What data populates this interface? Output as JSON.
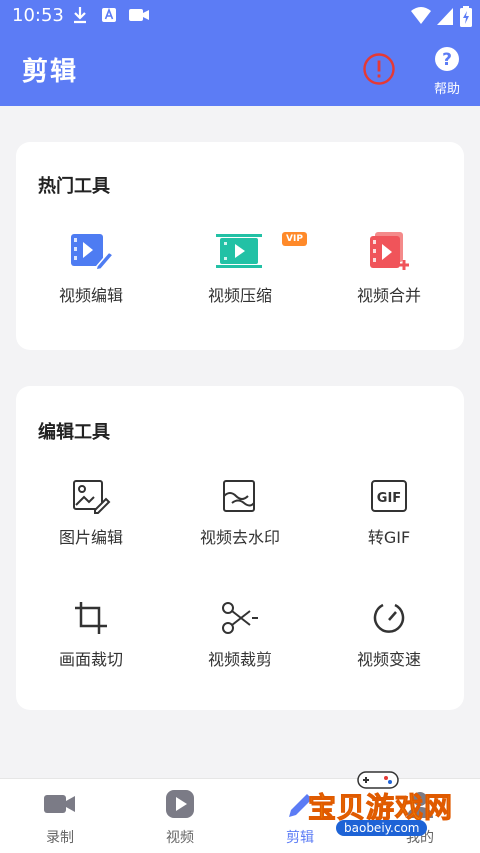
{
  "status_bar": {
    "time": "10:53"
  },
  "header": {
    "title": "剪辑",
    "help_label": "帮助"
  },
  "hot_tools": {
    "title": "热门工具",
    "items": [
      {
        "label": "视频编辑",
        "icon": "video-edit-icon"
      },
      {
        "label": "视频压缩",
        "icon": "video-compress-icon",
        "badge": "VIP"
      },
      {
        "label": "视频合并",
        "icon": "video-merge-icon"
      }
    ]
  },
  "edit_tools": {
    "title": "编辑工具",
    "items": [
      {
        "label": "图片编辑",
        "icon": "image-edit-icon"
      },
      {
        "label": "视频去水印",
        "icon": "watermark-remove-icon"
      },
      {
        "label": "转GIF",
        "icon": "gif-icon"
      },
      {
        "label": "画面裁切",
        "icon": "crop-icon"
      },
      {
        "label": "视频裁剪",
        "icon": "scissors-icon"
      },
      {
        "label": "视频变速",
        "icon": "speed-icon"
      }
    ]
  },
  "bottom_nav": {
    "items": [
      {
        "label": "录制",
        "icon": "camera-icon"
      },
      {
        "label": "视频",
        "icon": "play-icon"
      },
      {
        "label": "剪辑",
        "icon": "pen-icon",
        "active": true
      },
      {
        "label": "我的",
        "icon": "user-icon"
      }
    ]
  },
  "watermark": {
    "title": "宝贝游戏网",
    "url": "baobeiy.com"
  },
  "colors": {
    "primary": "#5c7cf5",
    "vip": "#ff8a2a",
    "warning": "#e53935"
  }
}
